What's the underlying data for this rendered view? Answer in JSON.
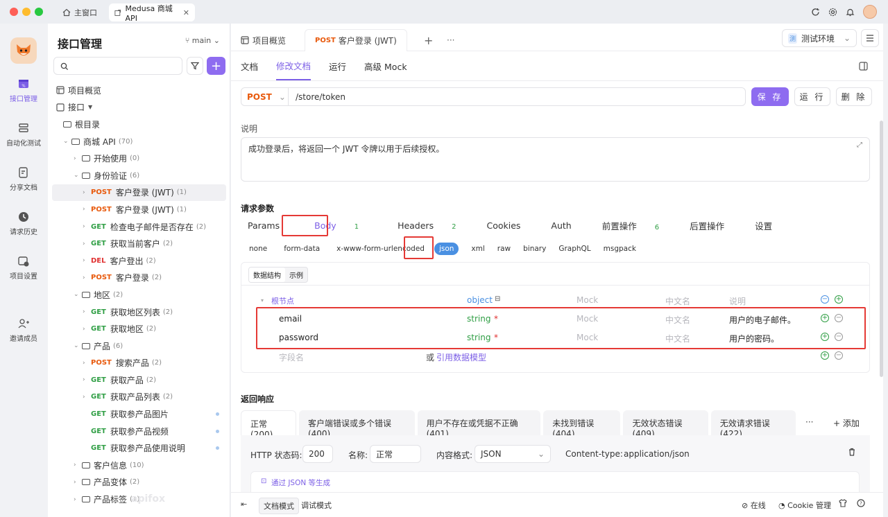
{
  "titlebar": {
    "home_tab": "主窗口",
    "active_tab": "Medusa 商城 API"
  },
  "rail": [
    {
      "label": "接口管理",
      "active": true
    },
    {
      "label": "自动化测试"
    },
    {
      "label": "分享文档"
    },
    {
      "label": "请求历史"
    },
    {
      "label": "项目设置"
    },
    {
      "label": "邀请成员"
    }
  ],
  "sidebar": {
    "title": "接口管理",
    "branch": "main",
    "overview": "项目概览",
    "api_root": "接口",
    "tree": [
      {
        "type": "folder",
        "label": "根目录",
        "level": 0
      },
      {
        "type": "folder",
        "label": "商城 API",
        "count": "(70)",
        "level": 1,
        "open": true
      },
      {
        "type": "folder",
        "label": "开始使用",
        "count": "(0)",
        "level": 2
      },
      {
        "type": "folder",
        "label": "身份验证",
        "count": "(6)",
        "level": 2,
        "open": true
      },
      {
        "type": "api",
        "method": "POST",
        "label": "客户登录 (JWT)",
        "count": "(1)",
        "level": 3,
        "selected": true
      },
      {
        "type": "api",
        "method": "POST",
        "label": "客户登录 (JWT)",
        "count": "(1)",
        "level": 3
      },
      {
        "type": "api",
        "method": "GET",
        "label": "检查电子邮件是否存在",
        "count": "(2)",
        "level": 3
      },
      {
        "type": "api",
        "method": "GET",
        "label": "获取当前客户",
        "count": "(2)",
        "level": 3
      },
      {
        "type": "api",
        "method": "DEL",
        "label": "客户登出",
        "count": "(2)",
        "level": 3
      },
      {
        "type": "api",
        "method": "POST",
        "label": "客户登录",
        "count": "(2)",
        "level": 3
      },
      {
        "type": "folder",
        "label": "地区",
        "count": "(2)",
        "level": 2,
        "open": true
      },
      {
        "type": "api",
        "method": "GET",
        "label": "获取地区列表",
        "count": "(2)",
        "level": 3
      },
      {
        "type": "api",
        "method": "GET",
        "label": "获取地区",
        "count": "(2)",
        "level": 3
      },
      {
        "type": "folder",
        "label": "产品",
        "count": "(6)",
        "level": 2,
        "open": true
      },
      {
        "type": "api",
        "method": "POST",
        "label": "搜索产品",
        "count": "(2)",
        "level": 3
      },
      {
        "type": "api",
        "method": "GET",
        "label": "获取产品",
        "count": "(2)",
        "level": 3
      },
      {
        "type": "api",
        "method": "GET",
        "label": "获取产品列表",
        "count": "(2)",
        "level": 3
      },
      {
        "type": "api",
        "method": "GET",
        "label": "获取参产品图片",
        "count": "",
        "level": 3,
        "dot": true
      },
      {
        "type": "api",
        "method": "GET",
        "label": "获取参产品视频",
        "count": "",
        "level": 3,
        "dot": true
      },
      {
        "type": "api",
        "method": "GET",
        "label": "获取参产品使用说明",
        "count": "",
        "level": 3,
        "dot": true
      },
      {
        "type": "folder",
        "label": "客户信息",
        "count": "(10)",
        "level": 2
      },
      {
        "type": "folder",
        "label": "产品变体",
        "count": "(2)",
        "level": 2
      },
      {
        "type": "folder",
        "label": "产品标签",
        "count": "(1)",
        "level": 2
      }
    ]
  },
  "main": {
    "doc_tabs": {
      "overview": "项目概览",
      "method": "POST",
      "active": "客户登录 (JWT)"
    },
    "env": {
      "icon_char": "测",
      "label": "测试环境"
    },
    "subtabs": [
      "文档",
      "修改文档",
      "运行",
      "高级 Mock"
    ],
    "method": "POST",
    "path": "/store/token",
    "buttons": {
      "save": "保 存",
      "run": "运 行",
      "delete": "删 除"
    },
    "desc_label": "说明",
    "description": "成功登录后，将返回一个 JWT 令牌以用于后续授权。",
    "params_title": "请求参数",
    "param_tabs": [
      {
        "label": "Params"
      },
      {
        "label": "Body",
        "n": "1"
      },
      {
        "label": "Headers",
        "n": "2"
      },
      {
        "label": "Cookies"
      },
      {
        "label": "Auth"
      },
      {
        "label": "前置操作",
        "n": "6"
      },
      {
        "label": "后置操作"
      },
      {
        "label": "设置"
      }
    ],
    "body_types": [
      "none",
      "form-data",
      "x-www-form-urlencoded",
      "json",
      "xml",
      "raw",
      "binary",
      "GraphQL",
      "msgpack"
    ],
    "schema": {
      "seg": [
        "数据结构",
        "示例"
      ],
      "root": {
        "name": "根节点",
        "type": "object",
        "mock": "Mock",
        "cn": "中文名",
        "desc": "说明"
      },
      "rows": [
        {
          "name": "email",
          "type": "string",
          "mock": "Mock",
          "cn": "中文名",
          "desc": "用户的电子邮件。"
        },
        {
          "name": "password",
          "type": "string",
          "mock": "Mock",
          "cn": "中文名",
          "desc": "用户的密码。"
        }
      ],
      "new_field": "字段名",
      "or": "或",
      "ref_model": "引用数据模型"
    },
    "resp_title": "返回响应",
    "resp_tabs": [
      "正常(200)",
      "客户端错误或多个错误(400)",
      "用户不存在或凭据不正确(401)",
      "未找到错误(404)",
      "无效状态错误(409)",
      "无效请求错误(422)"
    ],
    "resp_more": "···",
    "resp_add": "添加",
    "resp_meta": {
      "status_label": "HTTP 状态码:",
      "status": "200",
      "name_label": "名称:",
      "name": "正常",
      "format_label": "内容格式:",
      "format": "JSON",
      "ct_label": "Content-type:",
      "ct": "application/json",
      "gen": "通过 JSON 等生成"
    },
    "statusbar": {
      "doc_mode": "文档模式",
      "debug_mode": "调试模式",
      "online": "在线",
      "cookie": "Cookie 管理",
      "watermark": "apifox"
    }
  }
}
